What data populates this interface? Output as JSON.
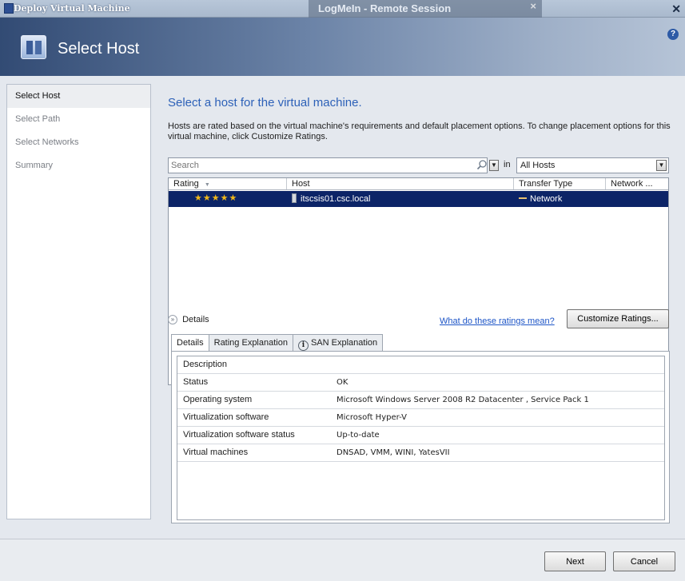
{
  "window": {
    "title": "Deploy Virtual Machine",
    "close_glyph": "✕"
  },
  "overlay": {
    "text": "LogMeIn - Remote Session",
    "close_glyph": "×"
  },
  "banner": {
    "heading": "Select Host",
    "help_glyph": "?"
  },
  "nav": {
    "steps": [
      {
        "label": "Select Host",
        "active": true
      },
      {
        "label": "Select Path",
        "active": false
      },
      {
        "label": "Select Networks",
        "active": false
      },
      {
        "label": "Summary",
        "active": false
      }
    ]
  },
  "main": {
    "heading": "Select a host for the virtual machine.",
    "description": "Hosts are rated based on the virtual machine's requirements and default placement options. To change placement options for this virtual machine, click Customize Ratings."
  },
  "search": {
    "placeholder": "Search",
    "in_label": "in",
    "scope_value": "All Hosts",
    "dropdown_glyph": "▼"
  },
  "hosts_grid": {
    "columns": [
      "Rating",
      "Host",
      "Transfer Type",
      "Network ..."
    ],
    "sort_glyph": "▼",
    "rows": [
      {
        "rating_stars": "★★★★★",
        "rating": 5,
        "host": "itscsis01.csc.local",
        "transfer_type": "Network",
        "network": ""
      }
    ]
  },
  "details": {
    "toggle_label": "Details",
    "toggle_glyph": "»",
    "ratings_link": "What do these ratings mean?",
    "customize_button": "Customize Ratings...",
    "tabs": [
      {
        "label": "Details",
        "active": true
      },
      {
        "label": "Rating Explanation",
        "active": false
      },
      {
        "label": "SAN Explanation",
        "active": false,
        "icon": "info-icon"
      }
    ],
    "info_glyph": "i",
    "header": "Description",
    "properties": [
      {
        "key": "Status",
        "value": "OK"
      },
      {
        "key": "Operating system",
        "value": "Microsoft Windows Server 2008 R2 Datacenter , Service Pack 1"
      },
      {
        "key": "Virtualization software",
        "value": "Microsoft Hyper-V"
      },
      {
        "key": "Virtualization software status",
        "value": "Up-to-date"
      },
      {
        "key": "Virtual machines",
        "value": "DNSAD, VMM, WINI, YatesVII"
      }
    ]
  },
  "footer": {
    "next_button": "Next",
    "cancel_button": "Cancel"
  },
  "colors": {
    "accent_heading": "#2d61b8",
    "selection": "#0c2467",
    "star": "#f0b81a",
    "link": "#1d55c7"
  }
}
